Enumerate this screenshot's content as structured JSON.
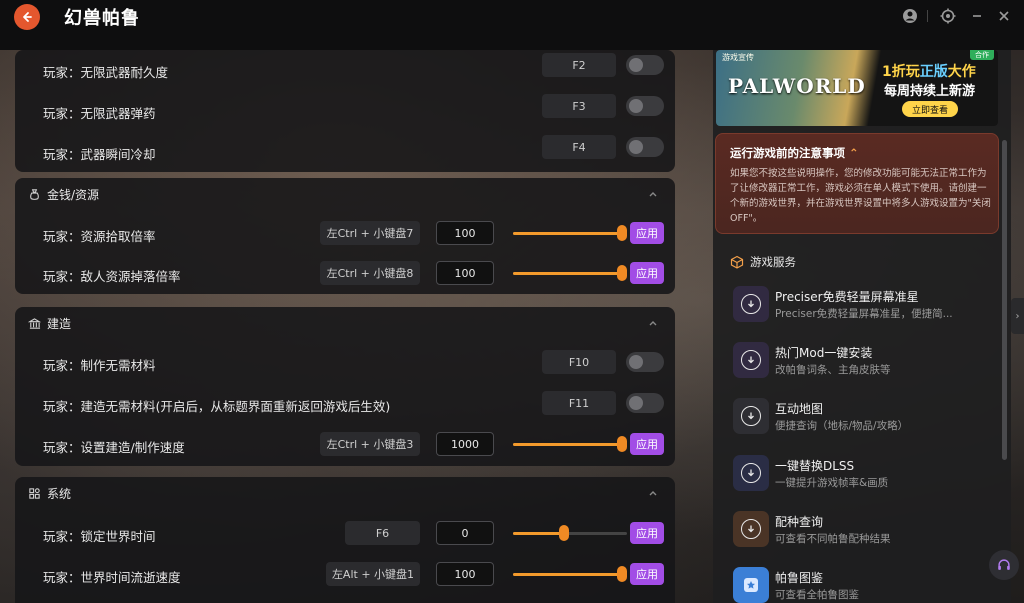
{
  "app": {
    "title": "幻兽帕鲁"
  },
  "sections": {
    "weapons": {
      "rows": [
        {
          "label": "玩家：无限武器耐久度",
          "hotkey": "F2",
          "toggle_on": false
        },
        {
          "label": "玩家：无限武器弹药",
          "hotkey": "F3",
          "toggle_on": false
        },
        {
          "label": "玩家：武器瞬间冷却",
          "hotkey": "F4",
          "toggle_on": false
        }
      ]
    },
    "money": {
      "title": "金钱/资源",
      "rows": [
        {
          "label": "玩家：资源拾取倍率",
          "hotkey": "左Ctrl + 小键盘7",
          "value": "100",
          "slider_fraction": 1.0,
          "apply": "应用"
        },
        {
          "label": "玩家：敌人资源掉落倍率",
          "hotkey": "左Ctrl + 小键盘8",
          "value": "100",
          "slider_fraction": 1.0,
          "apply": "应用"
        }
      ]
    },
    "build": {
      "title": "建造",
      "rows": [
        {
          "label": "玩家：制作无需材料",
          "hotkey": "F10",
          "toggle_on": false
        },
        {
          "label": "玩家：建造无需材料(开启后，从标题界面重新返回游戏后生效)",
          "hotkey": "F11",
          "toggle_on": false
        },
        {
          "label": "玩家：设置建造/制作速度",
          "hotkey": "左Ctrl + 小键盘3",
          "value": "1000",
          "slider_fraction": 1.0,
          "apply": "应用"
        }
      ]
    },
    "system": {
      "title": "系统",
      "rows": [
        {
          "label": "玩家：锁定世界时间",
          "hotkey": "F6",
          "value": "0",
          "slider_fraction": 0.45,
          "apply": "应用"
        },
        {
          "label": "玩家：世界时间流逝速度",
          "hotkey": "左Alt + 小键盘1",
          "value": "100",
          "slider_fraction": 1.0,
          "apply": "应用"
        }
      ]
    }
  },
  "banner": {
    "top_tag": "游戏宣传",
    "brand": "PALWORLD",
    "line1_a": "1折玩",
    "line1_b": "正版",
    "line1_c": "大作",
    "line2": "每周持续上新游",
    "cta": "立即查看",
    "corner": "合作"
  },
  "notice": {
    "title": "运行游戏前的注意事项",
    "body": "如果您不按这些说明操作，您的修改功能可能无法正常工作为了让修改器正常工作，游戏必须在单人模式下使用。请创建一个新的游戏世界，并在游戏世界设置中将多人游戏设置为\"关闭OFF\"。"
  },
  "services": {
    "title": "游戏服务",
    "items": [
      {
        "title": "Preciser免费轻量屏幕准星",
        "desc": "Preciser免费轻量屏幕准星，便捷简..."
      },
      {
        "title": "热门Mod一键安装",
        "desc": "改帕鲁词条、主角皮肤等"
      },
      {
        "title": "互动地图",
        "desc": "便捷查询（地标/物品/攻略）"
      },
      {
        "title": "一键替换DLSS",
        "desc": "一键提升游戏帧率&画质"
      },
      {
        "title": "配种查询",
        "desc": "可查看不同帕鲁配种结果"
      },
      {
        "title": "帕鲁图鉴",
        "desc": "可查看全帕鲁图鉴"
      }
    ]
  },
  "colors": {
    "accent_purple": "#a24de6",
    "slider_orange": "#f08a24",
    "back_orange": "#e4572e"
  }
}
